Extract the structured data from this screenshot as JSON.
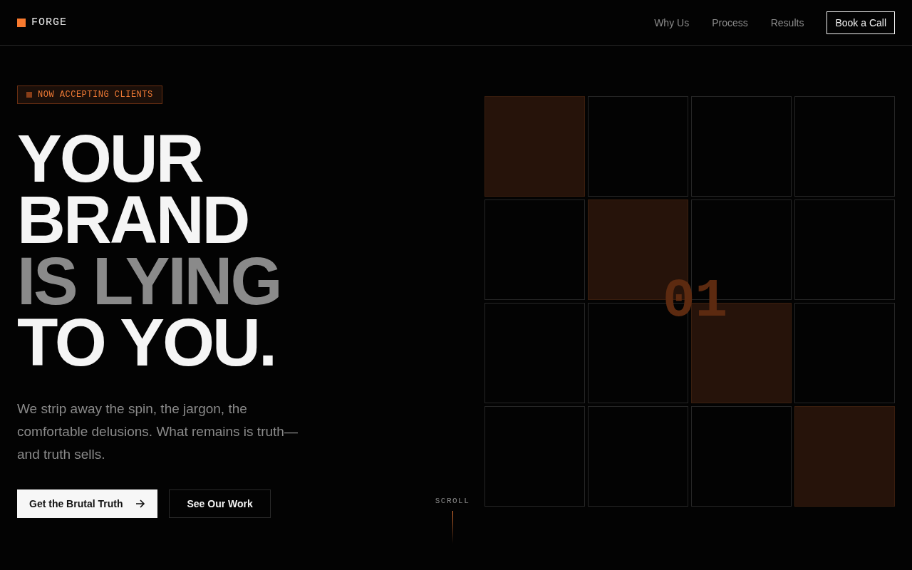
{
  "brand": {
    "name": "FORGE"
  },
  "nav": {
    "links": [
      "Why Us",
      "Process",
      "Results"
    ],
    "cta": "Book a Call"
  },
  "badge": "NOW ACCEPTING CLIENTS",
  "headline": [
    {
      "text": "YOUR",
      "kind": "plain"
    },
    {
      "text": "BRAND",
      "kind": "plain"
    },
    {
      "text": "IS LYING",
      "kind": "muted"
    },
    {
      "text": "TO YOU.",
      "kind": "plain"
    }
  ],
  "intro": "We strip away the spin, the jargon, the comfortable delusions. What remains is truth—and truth sells.",
  "buttons": [
    {
      "label": "Get the Brutal Truth",
      "kind": "primary"
    },
    {
      "label": "See Our Work",
      "kind": "outline"
    }
  ],
  "scroll_label": "SCROLL",
  "grid": {
    "number": "01",
    "tiles": [
      {
        "lit": true
      },
      {
        "lit": false
      },
      {
        "lit": false
      },
      {
        "lit": false
      },
      {
        "lit": false
      },
      {
        "lit": true
      },
      {
        "lit": false
      },
      {
        "lit": false
      },
      {
        "lit": false
      },
      {
        "lit": false
      },
      {
        "lit": true
      },
      {
        "lit": false
      },
      {
        "lit": false
      },
      {
        "lit": false
      },
      {
        "lit": false
      },
      {
        "lit": true
      }
    ]
  }
}
